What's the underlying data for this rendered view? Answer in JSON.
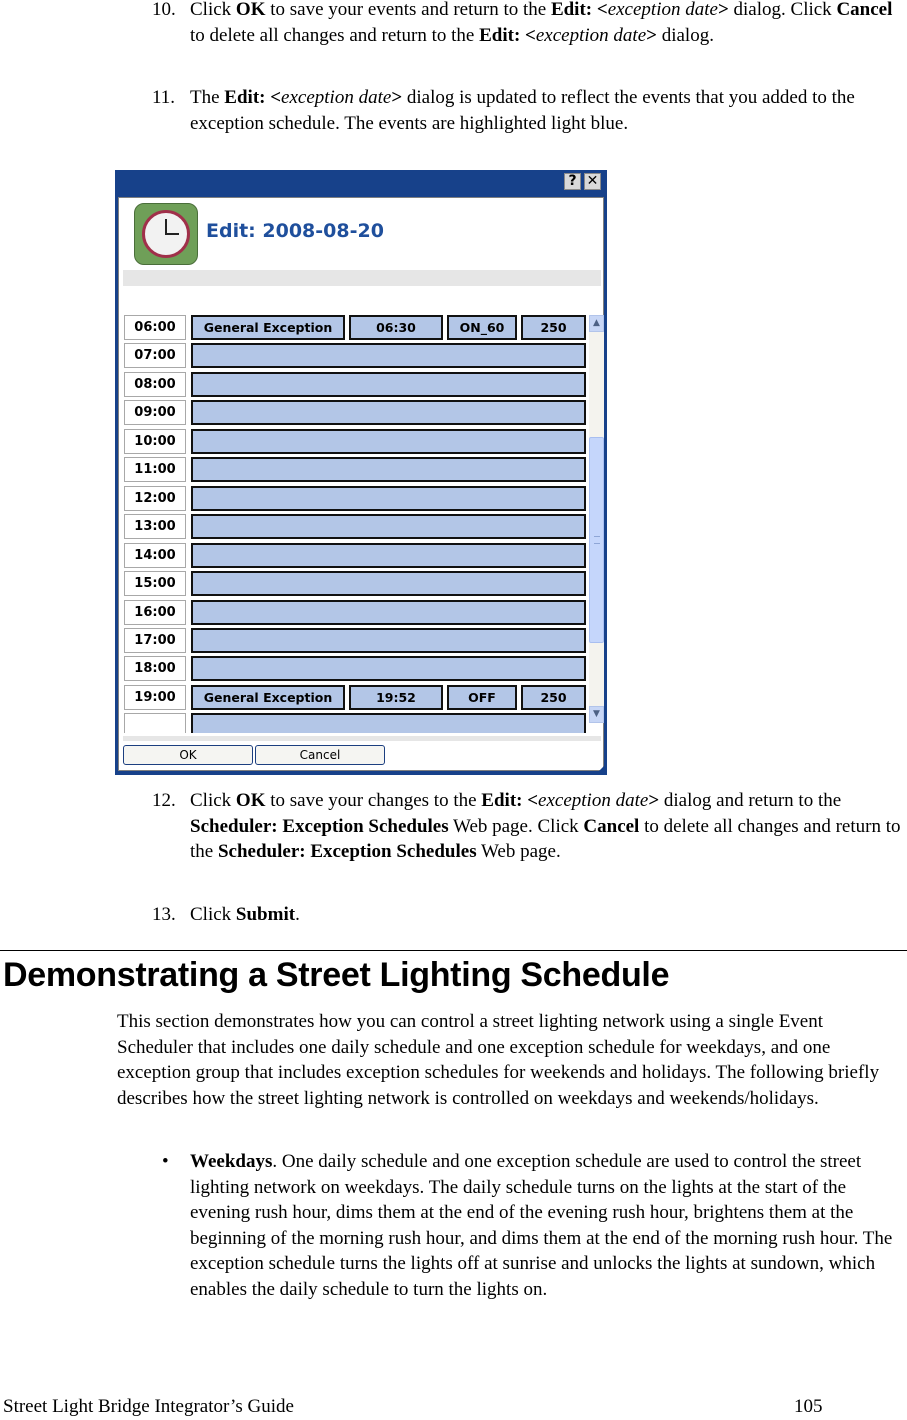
{
  "steps": {
    "step10": {
      "number": "10.",
      "t1": "Click ",
      "b1": "OK",
      "t2": " to save your events and return to the ",
      "b2": "Edit: <",
      "i1": "exception date",
      "b3": ">",
      "t3": " dialog.  Click ",
      "b4": "Cancel",
      "t4": " to delete all changes and return to the ",
      "b5": "Edit: <",
      "i2": "exception date",
      "b6": ">",
      "t5": " dialog."
    },
    "step11": {
      "number": "11.",
      "t1": "The ",
      "b1": "Edit: <",
      "i1": "exception date",
      "b2": ">",
      "t2": " dialog is updated to reflect the events that you added to the exception schedule.  The events are highlighted light blue."
    },
    "step12": {
      "number": "12.",
      "t1": "Click ",
      "b1": "OK",
      "t2": " to save your changes to the ",
      "b2": "Edit: <",
      "i1": "exception date",
      "b3": ">",
      "t3": " dialog and return to the ",
      "b4": "Scheduler: Exception Schedules",
      "t4": " Web page.  Click ",
      "b5": "Cancel",
      "t5": " to delete all changes and return to the ",
      "b6": "Scheduler: Exception Schedules",
      "t6": " Web page."
    },
    "step13": {
      "number": "13.",
      "t1": "Click ",
      "b1": "Submit",
      "t2": "."
    }
  },
  "dialog": {
    "help_icon": "?",
    "close_icon": "✕",
    "title": "Edit: 2008-08-20",
    "event_color": "#b3c6e7",
    "titlebar_color": "#17418a",
    "rows": [
      {
        "time": "06:00",
        "event": {
          "name": "General Exception",
          "start": "06:30",
          "state": "ON_60",
          "priority": "250"
        }
      },
      {
        "time": "07:00"
      },
      {
        "time": "08:00"
      },
      {
        "time": "09:00"
      },
      {
        "time": "10:00"
      },
      {
        "time": "11:00"
      },
      {
        "time": "12:00"
      },
      {
        "time": "13:00"
      },
      {
        "time": "14:00"
      },
      {
        "time": "15:00"
      },
      {
        "time": "16:00"
      },
      {
        "time": "17:00"
      },
      {
        "time": "18:00"
      },
      {
        "time": "19:00",
        "event": {
          "name": "General Exception",
          "start": "19:52",
          "state": "OFF",
          "priority": "250"
        }
      },
      {
        "time": ""
      }
    ],
    "ok_label": "OK",
    "cancel_label": "Cancel"
  },
  "section": {
    "heading": "Demonstrating a Street Lighting Schedule",
    "intro": "This section demonstrates how you can control a street lighting network using a single Event Scheduler that includes one daily schedule and one exception schedule for weekdays, and one exception group that includes exception schedules for weekends and holidays.  The following briefly describes how the street lighting network is controlled on weekdays and weekends/holidays.",
    "bullets": [
      {
        "marker": "•",
        "term": "Weekdays",
        "text": ".  One daily schedule and one exception schedule are used to control the street lighting network on weekdays.  The daily schedule turns on the lights at the start of the evening rush hour, dims them at the end of the evening rush hour, brightens them at the beginning of the morning rush hour, and dims them at the end of the morning rush hour. The exception schedule turns the lights off at sunrise and unlocks the lights at sundown, which enables the daily schedule to turn the lights on."
      }
    ]
  },
  "footer": {
    "title": "Street Light Bridge Integrator’s Guide",
    "page_number": "105"
  }
}
